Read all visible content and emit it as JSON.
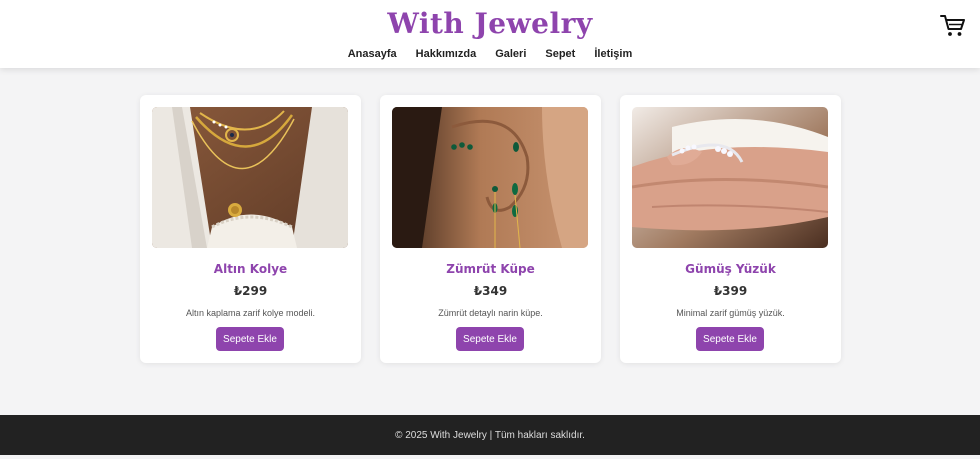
{
  "colors": {
    "accent": "#8e44ad",
    "footer_bg": "#222222",
    "page_bg": "#f4f4f5"
  },
  "header": {
    "title": "With Jewelry",
    "cart_icon": "shopping-cart-icon",
    "nav": [
      "Anasayfa",
      "Hakkımızda",
      "Galeri",
      "Sepet",
      "İletişim"
    ]
  },
  "products": [
    {
      "name": "Altın Kolye",
      "price": "₺299",
      "description": "Altın kaplama zarif kolye modeli.",
      "button_label": "Sepete Ekle",
      "image": "gold-necklace-photo"
    },
    {
      "name": "Zümrüt Küpe",
      "price": "₺349",
      "description": "Zümrüt detaylı narin küpe.",
      "button_label": "Sepete Ekle",
      "image": "emerald-earring-photo"
    },
    {
      "name": "Gümüş Yüzük",
      "price": "₺399",
      "description": "Minimal zarif gümüş yüzük.",
      "button_label": "Sepete Ekle",
      "image": "silver-ring-photo"
    }
  ],
  "footer": {
    "text": "© 2025 With Jewelry | Tüm hakları saklıdır."
  }
}
